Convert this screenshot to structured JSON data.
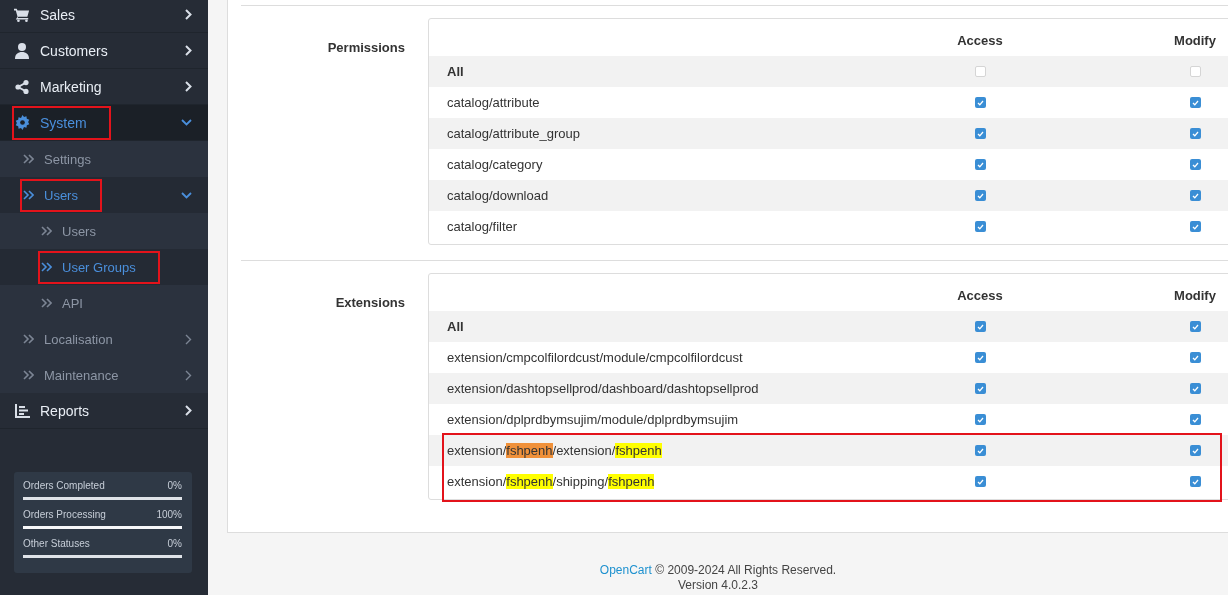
{
  "sidebar": {
    "items": [
      {
        "label": "Sales",
        "selected": false,
        "expanded": false,
        "annotated": false
      },
      {
        "label": "Customers",
        "selected": false,
        "expanded": false,
        "annotated": false
      },
      {
        "label": "Marketing",
        "selected": false,
        "expanded": false,
        "annotated": false
      },
      {
        "label": "System",
        "selected": true,
        "expanded": true,
        "annotated": true,
        "children": [
          {
            "label": "Settings",
            "selected": false,
            "annotated": false
          },
          {
            "label": "Users",
            "selected": true,
            "expanded": true,
            "annotated": true,
            "children": [
              {
                "label": "Users",
                "selected": false,
                "annotated": false
              },
              {
                "label": "User Groups",
                "selected": true,
                "annotated": true
              },
              {
                "label": "API",
                "selected": false,
                "annotated": false
              }
            ]
          },
          {
            "label": "Localisation",
            "selected": false,
            "expanded": false,
            "annotated": false
          },
          {
            "label": "Maintenance",
            "selected": false,
            "expanded": false,
            "annotated": false
          }
        ]
      },
      {
        "label": "Reports",
        "selected": false,
        "expanded": false,
        "annotated": false
      }
    ],
    "stats": [
      {
        "label": "Orders Completed",
        "value": "0%",
        "level": 0
      },
      {
        "label": "Orders Processing",
        "value": "100%",
        "level": 1
      },
      {
        "label": "Other Statuses",
        "value": "0%",
        "level": 0
      }
    ]
  },
  "sections": [
    {
      "label": "Permissions",
      "columns": [
        "Access",
        "Modify"
      ],
      "rows": [
        {
          "kind": "all",
          "name": "All",
          "access": false,
          "modify": false,
          "annotated": false
        },
        {
          "kind": "route",
          "name": "catalog/attribute",
          "access": true,
          "modify": true,
          "annotated": false
        },
        {
          "kind": "route",
          "name": "catalog/attribute_group",
          "access": true,
          "modify": true,
          "annotated": false
        },
        {
          "kind": "route",
          "name": "catalog/category",
          "access": true,
          "modify": true,
          "annotated": false
        },
        {
          "kind": "route",
          "name": "catalog/download",
          "access": true,
          "modify": true,
          "annotated": false
        },
        {
          "kind": "route",
          "name": "catalog/filter",
          "access": true,
          "modify": true,
          "annotated": false
        }
      ]
    },
    {
      "label": "Extensions",
      "columns": [
        "Access",
        "Modify"
      ],
      "rows": [
        {
          "kind": "all",
          "name": "All",
          "access": true,
          "modify": true,
          "annotated": false
        },
        {
          "kind": "route",
          "name": "extension/cmpcolfilordcust/module/cmpcolfilordcust",
          "access": true,
          "modify": true,
          "annotated": false
        },
        {
          "kind": "route",
          "name": "extension/dashtopsellprod/dashboard/dashtopsellprod",
          "access": true,
          "modify": true,
          "annotated": false
        },
        {
          "kind": "route",
          "name": "extension/dplprdbymsujim/module/dplprdbymsujim",
          "access": true,
          "modify": true,
          "annotated": false
        },
        {
          "kind": "route",
          "segments": [
            {
              "text": "extension/",
              "highlighted": false
            },
            {
              "text": "fshpenh",
              "highlighted": true,
              "current": true
            },
            {
              "text": "/extension/",
              "highlighted": false
            },
            {
              "text": "fshpenh",
              "highlighted": true,
              "current": false
            }
          ],
          "access": true,
          "modify": true,
          "annotated": true
        },
        {
          "kind": "route",
          "segments": [
            {
              "text": "extension/",
              "highlighted": false
            },
            {
              "text": "fshpenh",
              "highlighted": true,
              "current": false
            },
            {
              "text": "/shipping/",
              "highlighted": false
            },
            {
              "text": "fshpenh",
              "highlighted": true,
              "current": false
            }
          ],
          "access": true,
          "modify": true,
          "annotated": true
        }
      ]
    }
  ],
  "footer": {
    "link": "OpenCart",
    "copyright": "© 2009-2024 All Rights Reserved.",
    "version": "Version 4.0.2.3"
  }
}
